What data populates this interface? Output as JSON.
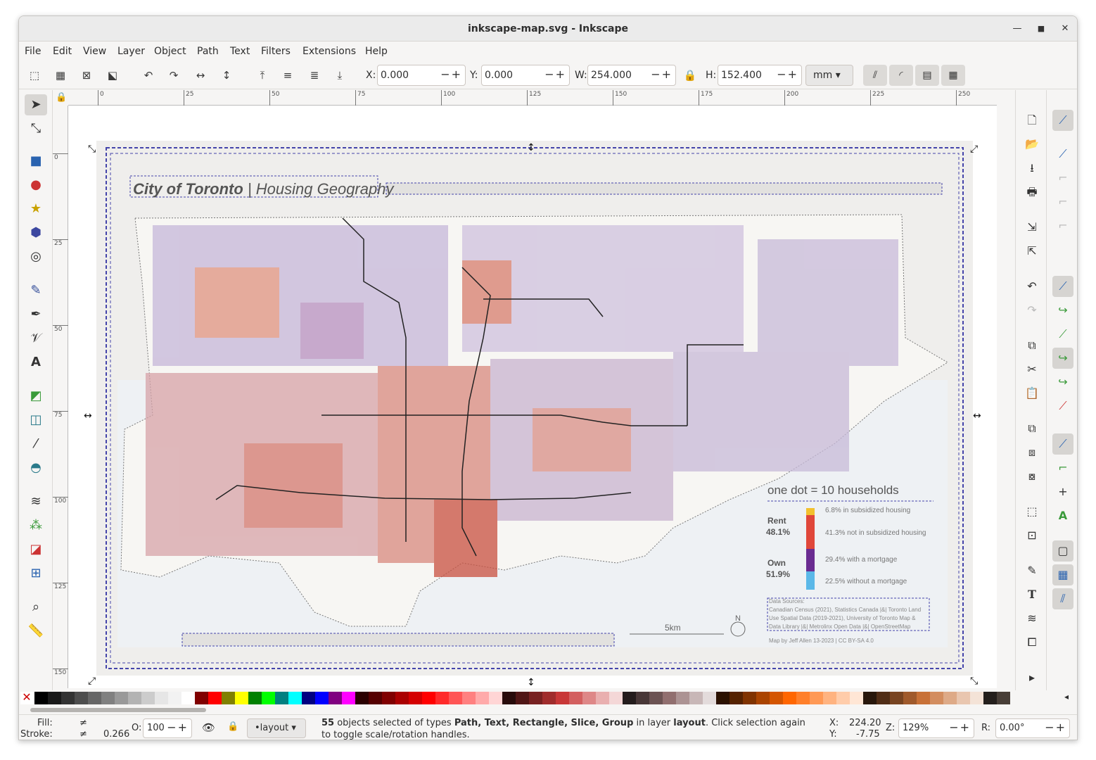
{
  "window": {
    "title": "inkscape-map.svg - Inkscape"
  },
  "menu": [
    "File",
    "Edit",
    "View",
    "Layer",
    "Object",
    "Path",
    "Text",
    "Filters",
    "Extensions",
    "Help"
  ],
  "toolbar": {
    "x_label": "X:",
    "x_value": "0.000",
    "y_label": "Y:",
    "y_value": "0.000",
    "w_label": "W:",
    "w_value": "254.000",
    "h_label": "H:",
    "h_value": "152.400",
    "unit": "mm"
  },
  "ruler_h": [
    "0",
    "25",
    "50",
    "75",
    "100",
    "125",
    "150",
    "175",
    "200",
    "225",
    "250"
  ],
  "ruler_v": [
    "0",
    "25",
    "50",
    "75",
    "100",
    "125",
    "150"
  ],
  "map": {
    "title_bold": "City of Toronto",
    "title_sep": " | ",
    "title_light": "Housing Geography",
    "legend_heading": "one dot = 10 households",
    "rent_label": "Rent",
    "rent_pct": "48.1%",
    "own_label": "Own",
    "own_pct": "51.9%",
    "items": [
      {
        "pct": "6.8%",
        "label": "in subsidized housing",
        "color": "#f2c12e"
      },
      {
        "pct": "41.3%",
        "label": "not in subsidized housing",
        "color": "#e0473a"
      },
      {
        "pct": "29.4%",
        "label": "with a mortgage",
        "color": "#6a2c91"
      },
      {
        "pct": "22.5%",
        "label": "without a mortgage",
        "color": "#5bb8e8"
      }
    ],
    "sources_heading": "Data Sources:",
    "sources_line1": "Canadian Census (2021), Statistics Canada |&| Toronto Land",
    "sources_line2": "Use Spatial Data (2019-2021), University of Toronto Map &",
    "sources_line3": "Data Library |&| Metrolinx Open Data |&| OpenStreetMap",
    "footer_note": "Map by Jeff Allen 13-2023 | CC BY-SA 4.0",
    "scale_label": "5km",
    "north_label": "N"
  },
  "status": {
    "fill_label": "Fill:",
    "fill_value": "≠",
    "stroke_label": "Stroke:",
    "stroke_value": "≠",
    "stroke_width": "0.266",
    "opacity_label": "O:",
    "opacity_value": "100",
    "layer": "•layout",
    "msg_count": "55",
    "msg_a": " objects selected of types ",
    "msg_types": "Path, Text, Rectangle, Slice, Group",
    "msg_b": " in layer ",
    "msg_layer": "layout",
    "msg_c": ". Click selection again to toggle scale/rotation handles.",
    "cursor_x_label": "X:",
    "cursor_x": "224.20",
    "cursor_y_label": "Y:",
    "cursor_y": "-7.75",
    "zoom_label": "Z:",
    "zoom": "129%",
    "rotation_label": "R:",
    "rotation": "0.00°"
  },
  "palette": [
    "#000000",
    "#1a1a1a",
    "#333333",
    "#4d4d4d",
    "#666666",
    "#808080",
    "#999999",
    "#b3b3b3",
    "#cccccc",
    "#e6e6e6",
    "#f2f2f2",
    "#ffffff",
    "#800000",
    "#ff0000",
    "#808000",
    "#ffff00",
    "#008000",
    "#00ff00",
    "#008080",
    "#00ffff",
    "#000080",
    "#0000ff",
    "#800080",
    "#ff00ff",
    "#2b0000",
    "#550000",
    "#800000",
    "#aa0000",
    "#d40000",
    "#ff0000",
    "#ff2a2a",
    "#ff5555",
    "#ff8080",
    "#ffaaaa",
    "#ffd5d5",
    "#280b0b",
    "#501616",
    "#782121",
    "#a02c2c",
    "#c83737",
    "#d35f5f",
    "#de8787",
    "#e9afaf",
    "#f4d7d7",
    "#241c1c",
    "#483737",
    "#6c5353",
    "#916f6f",
    "#ac9393",
    "#c8b7b7",
    "#e3dbdb",
    "#2b1100",
    "#552200",
    "#803300",
    "#aa4400",
    "#d45500",
    "#ff6600",
    "#ff7f2a",
    "#ff9955",
    "#ffb380",
    "#ffccaa",
    "#ffe6d5",
    "#28170b",
    "#502d16",
    "#784421",
    "#a05a2c",
    "#c87137",
    "#d38d5f",
    "#deaa87",
    "#e9c6af",
    "#f4e3d7",
    "#241f1c",
    "#483e37"
  ]
}
